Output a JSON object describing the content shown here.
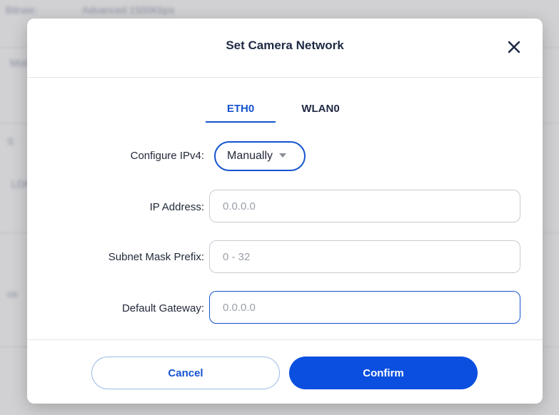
{
  "background": {
    "texts": [
      "Bitrate:",
      "Advanced 1500Kbps",
      "Motion",
      "LOR",
      "S",
      "ce"
    ]
  },
  "dialog": {
    "title": "Set Camera Network",
    "close_icon": "close-icon",
    "tabs": [
      {
        "label": "ETH0",
        "active": true
      },
      {
        "label": "WLAN0",
        "active": false
      }
    ],
    "form": {
      "ipv4_label": "Configure IPv4:",
      "ipv4_value": "Manually",
      "ip_label": "IP Address:",
      "ip_placeholder": "0.0.0.0",
      "subnet_label": "Subnet Mask Prefix:",
      "subnet_placeholder": "0 - 32",
      "gateway_label": "Default Gateway:",
      "gateway_placeholder": "0.0.0.0"
    },
    "buttons": {
      "cancel": "Cancel",
      "confirm": "Confirm"
    }
  },
  "colors": {
    "accent": "#1553cf",
    "confirm_bg": "#0a4fe0",
    "title_text": "#1f2a44"
  }
}
